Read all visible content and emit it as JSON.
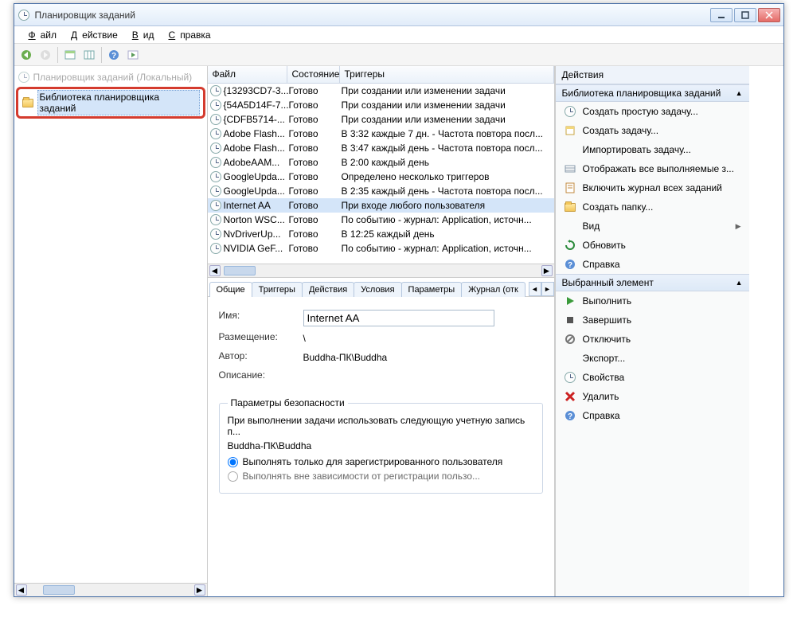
{
  "window": {
    "title": "Планировщик заданий"
  },
  "menu": {
    "file": "Файл",
    "action": "Действие",
    "view": "Вид",
    "help": "Справка"
  },
  "tree": {
    "root": "Планировщик заданий (Локальный)",
    "lib": "Библиотека планировщика заданий"
  },
  "columns": {
    "name": "Файл",
    "state": "Состояние",
    "triggers": "Триггеры"
  },
  "tasks": [
    {
      "name": "{13293CD7-3...",
      "state": "Готово",
      "trig": "При создании или изменении задачи"
    },
    {
      "name": "{54A5D14F-7...",
      "state": "Готово",
      "trig": "При создании или изменении задачи"
    },
    {
      "name": "{CDFB5714-...",
      "state": "Готово",
      "trig": "При создании или изменении задачи"
    },
    {
      "name": "Adobe Flash...",
      "state": "Готово",
      "trig": "В 3:32 каждые 7 дн. - Частота повтора посл..."
    },
    {
      "name": "Adobe Flash...",
      "state": "Готово",
      "trig": "В 3:47 каждый день - Частота повтора посл..."
    },
    {
      "name": "AdobeAAM...",
      "state": "Готово",
      "trig": "В 2:00 каждый день"
    },
    {
      "name": "GoogleUpda...",
      "state": "Готово",
      "trig": "Определено несколько триггеров"
    },
    {
      "name": "GoogleUpda...",
      "state": "Готово",
      "trig": "В 2:35 каждый день - Частота повтора посл..."
    },
    {
      "name": "Internet AA",
      "state": "Готово",
      "trig": "При входе любого пользователя"
    },
    {
      "name": "Norton WSC...",
      "state": "Готово",
      "trig": "По событию - журнал: Application, источн..."
    },
    {
      "name": "NvDriverUp...",
      "state": "Готово",
      "trig": "В 12:25 каждый день"
    },
    {
      "name": "NVIDIA GeF...",
      "state": "Готово",
      "trig": "По событию - журнал: Application, источн..."
    }
  ],
  "tabs": [
    "Общие",
    "Триггеры",
    "Действия",
    "Условия",
    "Параметры",
    "Журнал (отк"
  ],
  "details": {
    "name_label": "Имя:",
    "name_value": "Internet AA",
    "location_label": "Размещение:",
    "location_value": "\\",
    "author_label": "Автор:",
    "author_value": "Buddha-ПК\\Buddha",
    "desc_label": "Описание:",
    "sec_legend": "Параметры безопасности",
    "sec_text": "При выполнении задачи использовать следующую учетную запись п...",
    "sec_user": "Buddha-ПК\\Buddha",
    "radio1": "Выполнять только для зарегистрированного пользователя",
    "radio2": "Выполнять вне зависимости от регистрации пользо..."
  },
  "actions": {
    "header": "Действия",
    "group1": "Библиотека планировщика заданий",
    "items1": [
      {
        "icon": "clock-icon",
        "label": "Создать простую задачу..."
      },
      {
        "icon": "task-icon",
        "label": "Создать задачу..."
      },
      {
        "icon": "import-icon",
        "label": "Импортировать задачу..."
      },
      {
        "icon": "show-icon",
        "label": "Отображать все выполняемые з..."
      },
      {
        "icon": "log-icon",
        "label": "Включить журнал всех заданий"
      },
      {
        "icon": "folder-icon",
        "label": "Создать папку..."
      },
      {
        "icon": "",
        "label": "Вид",
        "arrow": true
      },
      {
        "icon": "refresh-icon",
        "label": "Обновить"
      },
      {
        "icon": "help-icon",
        "label": "Справка"
      }
    ],
    "group2": "Выбранный элемент",
    "items2": [
      {
        "icon": "run-icon",
        "label": "Выполнить"
      },
      {
        "icon": "stop-icon",
        "label": "Завершить"
      },
      {
        "icon": "disable-icon",
        "label": "Отключить"
      },
      {
        "icon": "export-icon",
        "label": "Экспорт..."
      },
      {
        "icon": "props-icon",
        "label": "Свойства"
      },
      {
        "icon": "delete-icon",
        "label": "Удалить"
      },
      {
        "icon": "help-icon",
        "label": "Справка"
      }
    ]
  }
}
